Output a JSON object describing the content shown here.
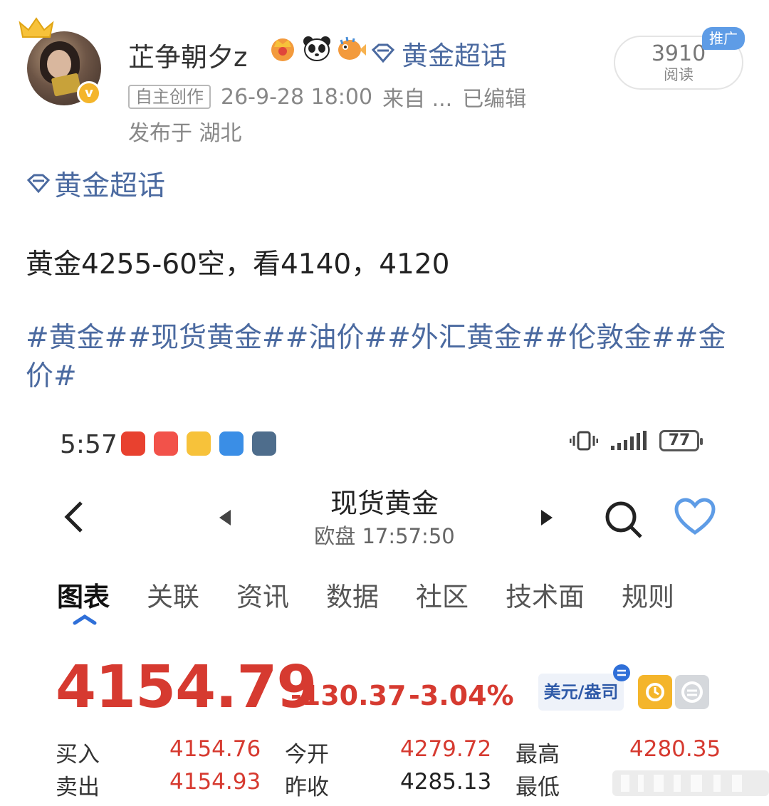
{
  "post": {
    "username": "芷争朝夕z",
    "topic_head": "黄金超话",
    "read_count": "3910",
    "read_label": "阅读",
    "promo_tag": "推广",
    "original_tag": "自主创作",
    "timestamp": "26-9-28 18:00",
    "source": "来自 ...",
    "edited": "已编辑",
    "location": "发布于 湖北",
    "topic_link": "黄金超话",
    "text": "黄金4255-60空，看4140，4120",
    "hashtags": "#黄金##现货黄金##油价##外汇黄金##伦敦金##金价#",
    "badges": [
      "crown-badge-icon",
      "panda-badge-icon",
      "pufferfish-badge-icon"
    ]
  },
  "screenshot": {
    "status_time": "5:57",
    "battery": "77",
    "app_icons": [
      "news-app-icon",
      "shopping-app-icon",
      "weibo-app-icon",
      "weather-app-icon",
      "photo-app-icon"
    ],
    "title": "现货黄金",
    "subtitle": "欧盘  17:57:50",
    "tabs": [
      "图表",
      "关联",
      "资讯",
      "数据",
      "社区",
      "技术面",
      "规则"
    ],
    "active_tab": "图表",
    "price": "4154.79",
    "change": "-130.37",
    "change_pct": "-3.04%",
    "currency_label": "美元/盎司",
    "stats": {
      "buy_label": "买入",
      "buy": "4154.76",
      "sell_label": "卖出",
      "sell": "4154.93",
      "open_label": "今开",
      "open": "4279.72",
      "prev_close_label": "昨收",
      "prev_close": "4285.13",
      "high_label": "最高",
      "high": "4280.35",
      "low_label": "最低"
    }
  },
  "colors": {
    "link": "#4b6aa0",
    "down_red": "#d63a30",
    "verified": "#f4b52b",
    "heart": "#5e9ce6"
  }
}
